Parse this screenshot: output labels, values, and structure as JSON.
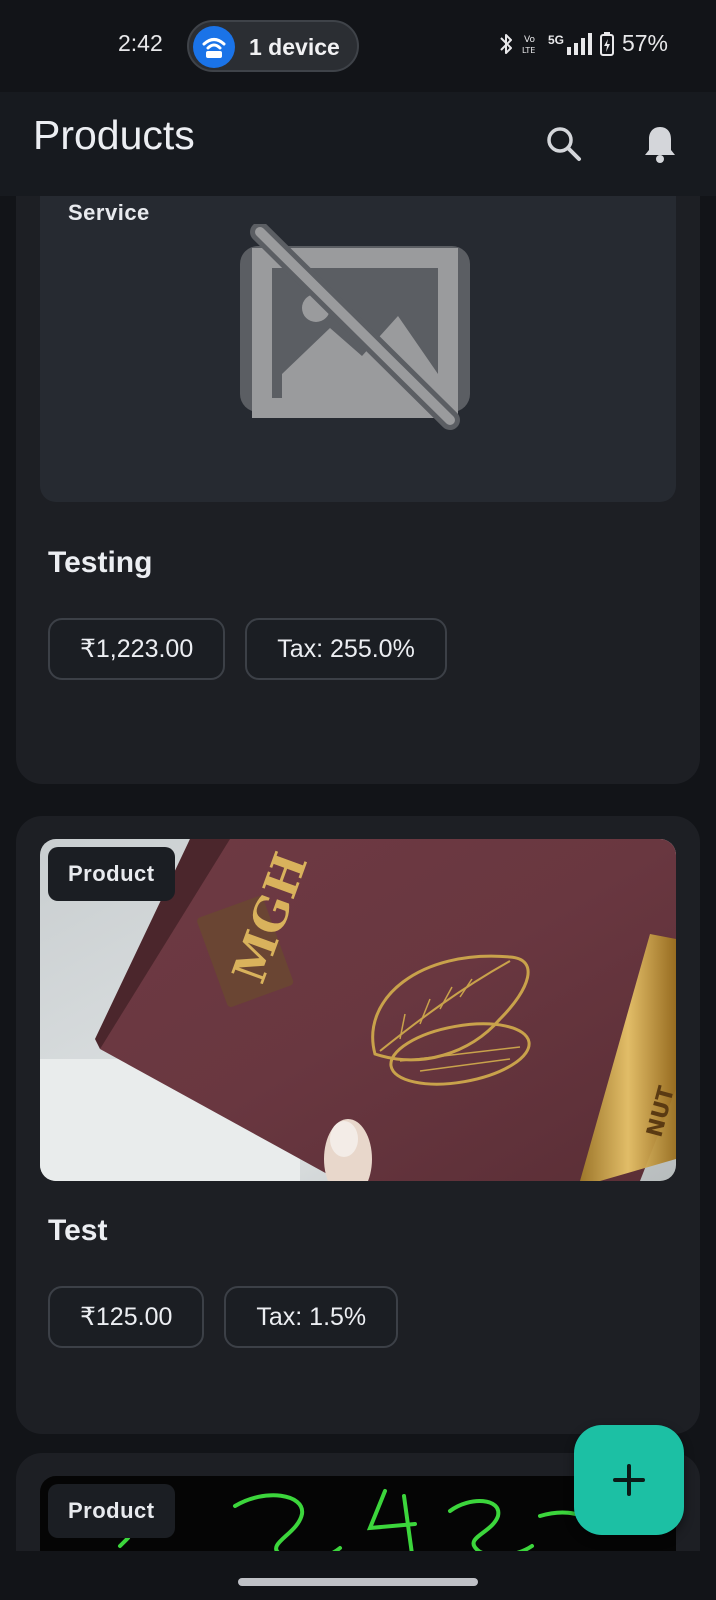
{
  "status_bar": {
    "time": "2:42",
    "hotspot_label": "1 device",
    "network": "5G",
    "battery": "57%"
  },
  "app_bar": {
    "title": "Products",
    "search_icon": "search-icon",
    "notification_icon": "bell-icon"
  },
  "products": [
    {
      "type": "Service",
      "name": "Testing",
      "price": "₹1,223.00",
      "tax": "Tax: 255.0%",
      "image": "no-image-placeholder"
    },
    {
      "type": "Product",
      "name": "Test",
      "price": "₹125.00",
      "tax": "Tax: 1.5%",
      "image": "chocolate-box-photo"
    },
    {
      "type": "Product",
      "name": "",
      "price": "",
      "tax": "",
      "image": "handwriting-photo"
    }
  ],
  "fab": {
    "icon": "plus-icon"
  },
  "colors": {
    "background": "#121418",
    "card": "#1d1f24",
    "accent": "#1cc0a4",
    "hotspot": "#1a73e8"
  }
}
